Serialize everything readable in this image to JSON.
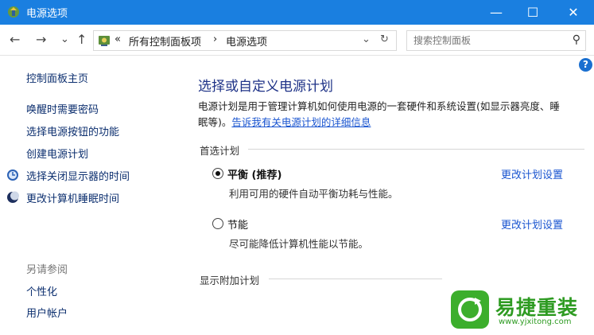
{
  "window": {
    "title": "电源选项",
    "controls": [
      "minimize",
      "maximize",
      "close"
    ],
    "glyphs": {
      "minimize": "—",
      "maximize": "☐",
      "close": "✕"
    }
  },
  "toolbar": {
    "back_glyph": "←",
    "forward_glyph": "→",
    "recent_glyph": "⌄",
    "up_glyph": "↑",
    "breadcrumb": [
      "«",
      "所有控制面板项",
      "›",
      "电源选项"
    ],
    "dropdown_glyph": "⌄",
    "refresh_glyph": "↻",
    "search_placeholder": "搜索控制面板",
    "search_glyph": "⚲"
  },
  "help_glyph": "?",
  "sidebar": {
    "home": "控制面板主页",
    "items": [
      "唤醒时需要密码",
      "选择电源按钮的功能",
      "创建电源计划",
      "选择关闭显示器的时间",
      "更改计算机睡眠时间"
    ],
    "see_also_title": "另请参阅",
    "see_also": [
      "个性化",
      "用户帐户"
    ]
  },
  "main": {
    "heading": "选择或自定义电源计划",
    "description": "电源计划是用于管理计算机如何使用电源的一套硬件和系统设置(如显示器亮度、睡眠等)。",
    "description_line1": "电源计划是用于管理计算机如何使用电源的一套硬件和系统设置(如显示器亮度、睡",
    "description_line2_prefix": "眠等)。",
    "learn_more_link": "告诉我有关电源计划的详细信息",
    "preferred_title": "首选计划",
    "plans": [
      {
        "name": "平衡 (推荐)",
        "desc": "利用可用的硬件自动平衡功耗与性能。",
        "selected": true,
        "change_link": "更改计划设置"
      },
      {
        "name": "节能",
        "desc": "尽可能降低计算机性能以节能。",
        "selected": false,
        "change_link": "更改计划设置"
      }
    ],
    "show_more": "显示附加计划"
  },
  "watermark": {
    "brand": "易捷重装",
    "url": "www.yjxitong.com",
    "color": "#3cae2c"
  },
  "colors": {
    "titlebar": "#1a7fe0",
    "link": "#1a55d0",
    "heading": "#1e3287"
  }
}
